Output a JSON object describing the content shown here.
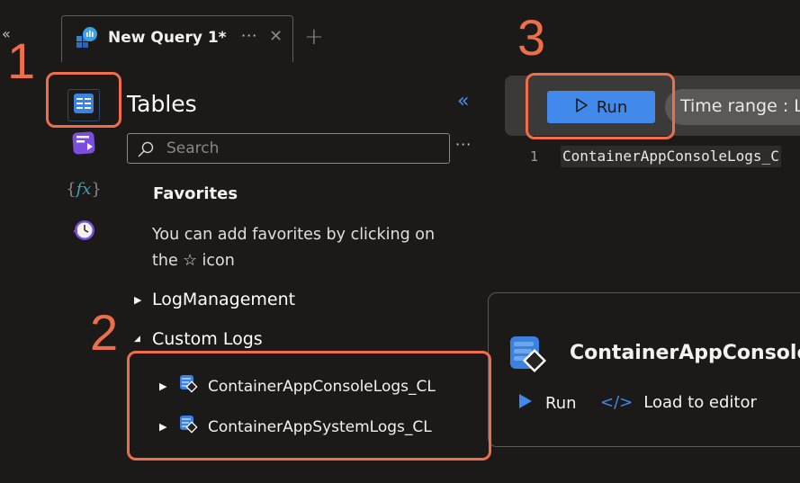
{
  "tab_bar": {
    "collapse_icon": "double-chevron-left-icon",
    "active_tab": {
      "icon": "log-analytics-query-icon",
      "title": "New Query 1*",
      "more_label": "···",
      "close_label": "✕"
    },
    "add_tab_label": "+"
  },
  "left_rail": {
    "items": [
      {
        "name": "tables",
        "icon": "tables-icon",
        "selected": true
      },
      {
        "name": "queries",
        "icon": "queries-icon",
        "selected": false
      },
      {
        "name": "functions",
        "icon": "functions-icon",
        "selected": false,
        "glyph": "{fx}"
      },
      {
        "name": "query-history",
        "icon": "history-clock-icon",
        "selected": false
      }
    ]
  },
  "tables_panel": {
    "title": "Tables",
    "collapse_label": "«",
    "search": {
      "placeholder": "Search",
      "value": ""
    },
    "more_label": "···",
    "favorites": {
      "title": "Favorites",
      "hint_line1": "You can add favorites by clicking on",
      "hint_line2": "the ☆ icon"
    },
    "groups": [
      {
        "label": "LogManagement",
        "expanded": false,
        "caret": "▶"
      },
      {
        "label": "Custom Logs",
        "expanded": true,
        "caret": "◢"
      }
    ],
    "custom_tables": [
      {
        "label": "ContainerAppConsoleLogs_CL",
        "caret": "▶"
      },
      {
        "label": "ContainerAppSystemLogs_CL",
        "caret": "▶"
      }
    ]
  },
  "editor": {
    "run_label": "Run",
    "run_icon": "▷",
    "time_range_label": "Time range :  L",
    "lines": [
      {
        "number": "1",
        "code": "ContainerAppConsoleLogs_C"
      }
    ]
  },
  "detail_card": {
    "title": "ContainerAppConsoleLo",
    "run_label": "Run",
    "load_label": "Load to editor"
  },
  "annotations": {
    "step1": "1",
    "step2": "2",
    "step3": "3",
    "color": "#ee6e4a"
  },
  "colors": {
    "background": "#1b1a19",
    "accent_blue": "#4289ec",
    "toolbar": "#3b3a39"
  }
}
